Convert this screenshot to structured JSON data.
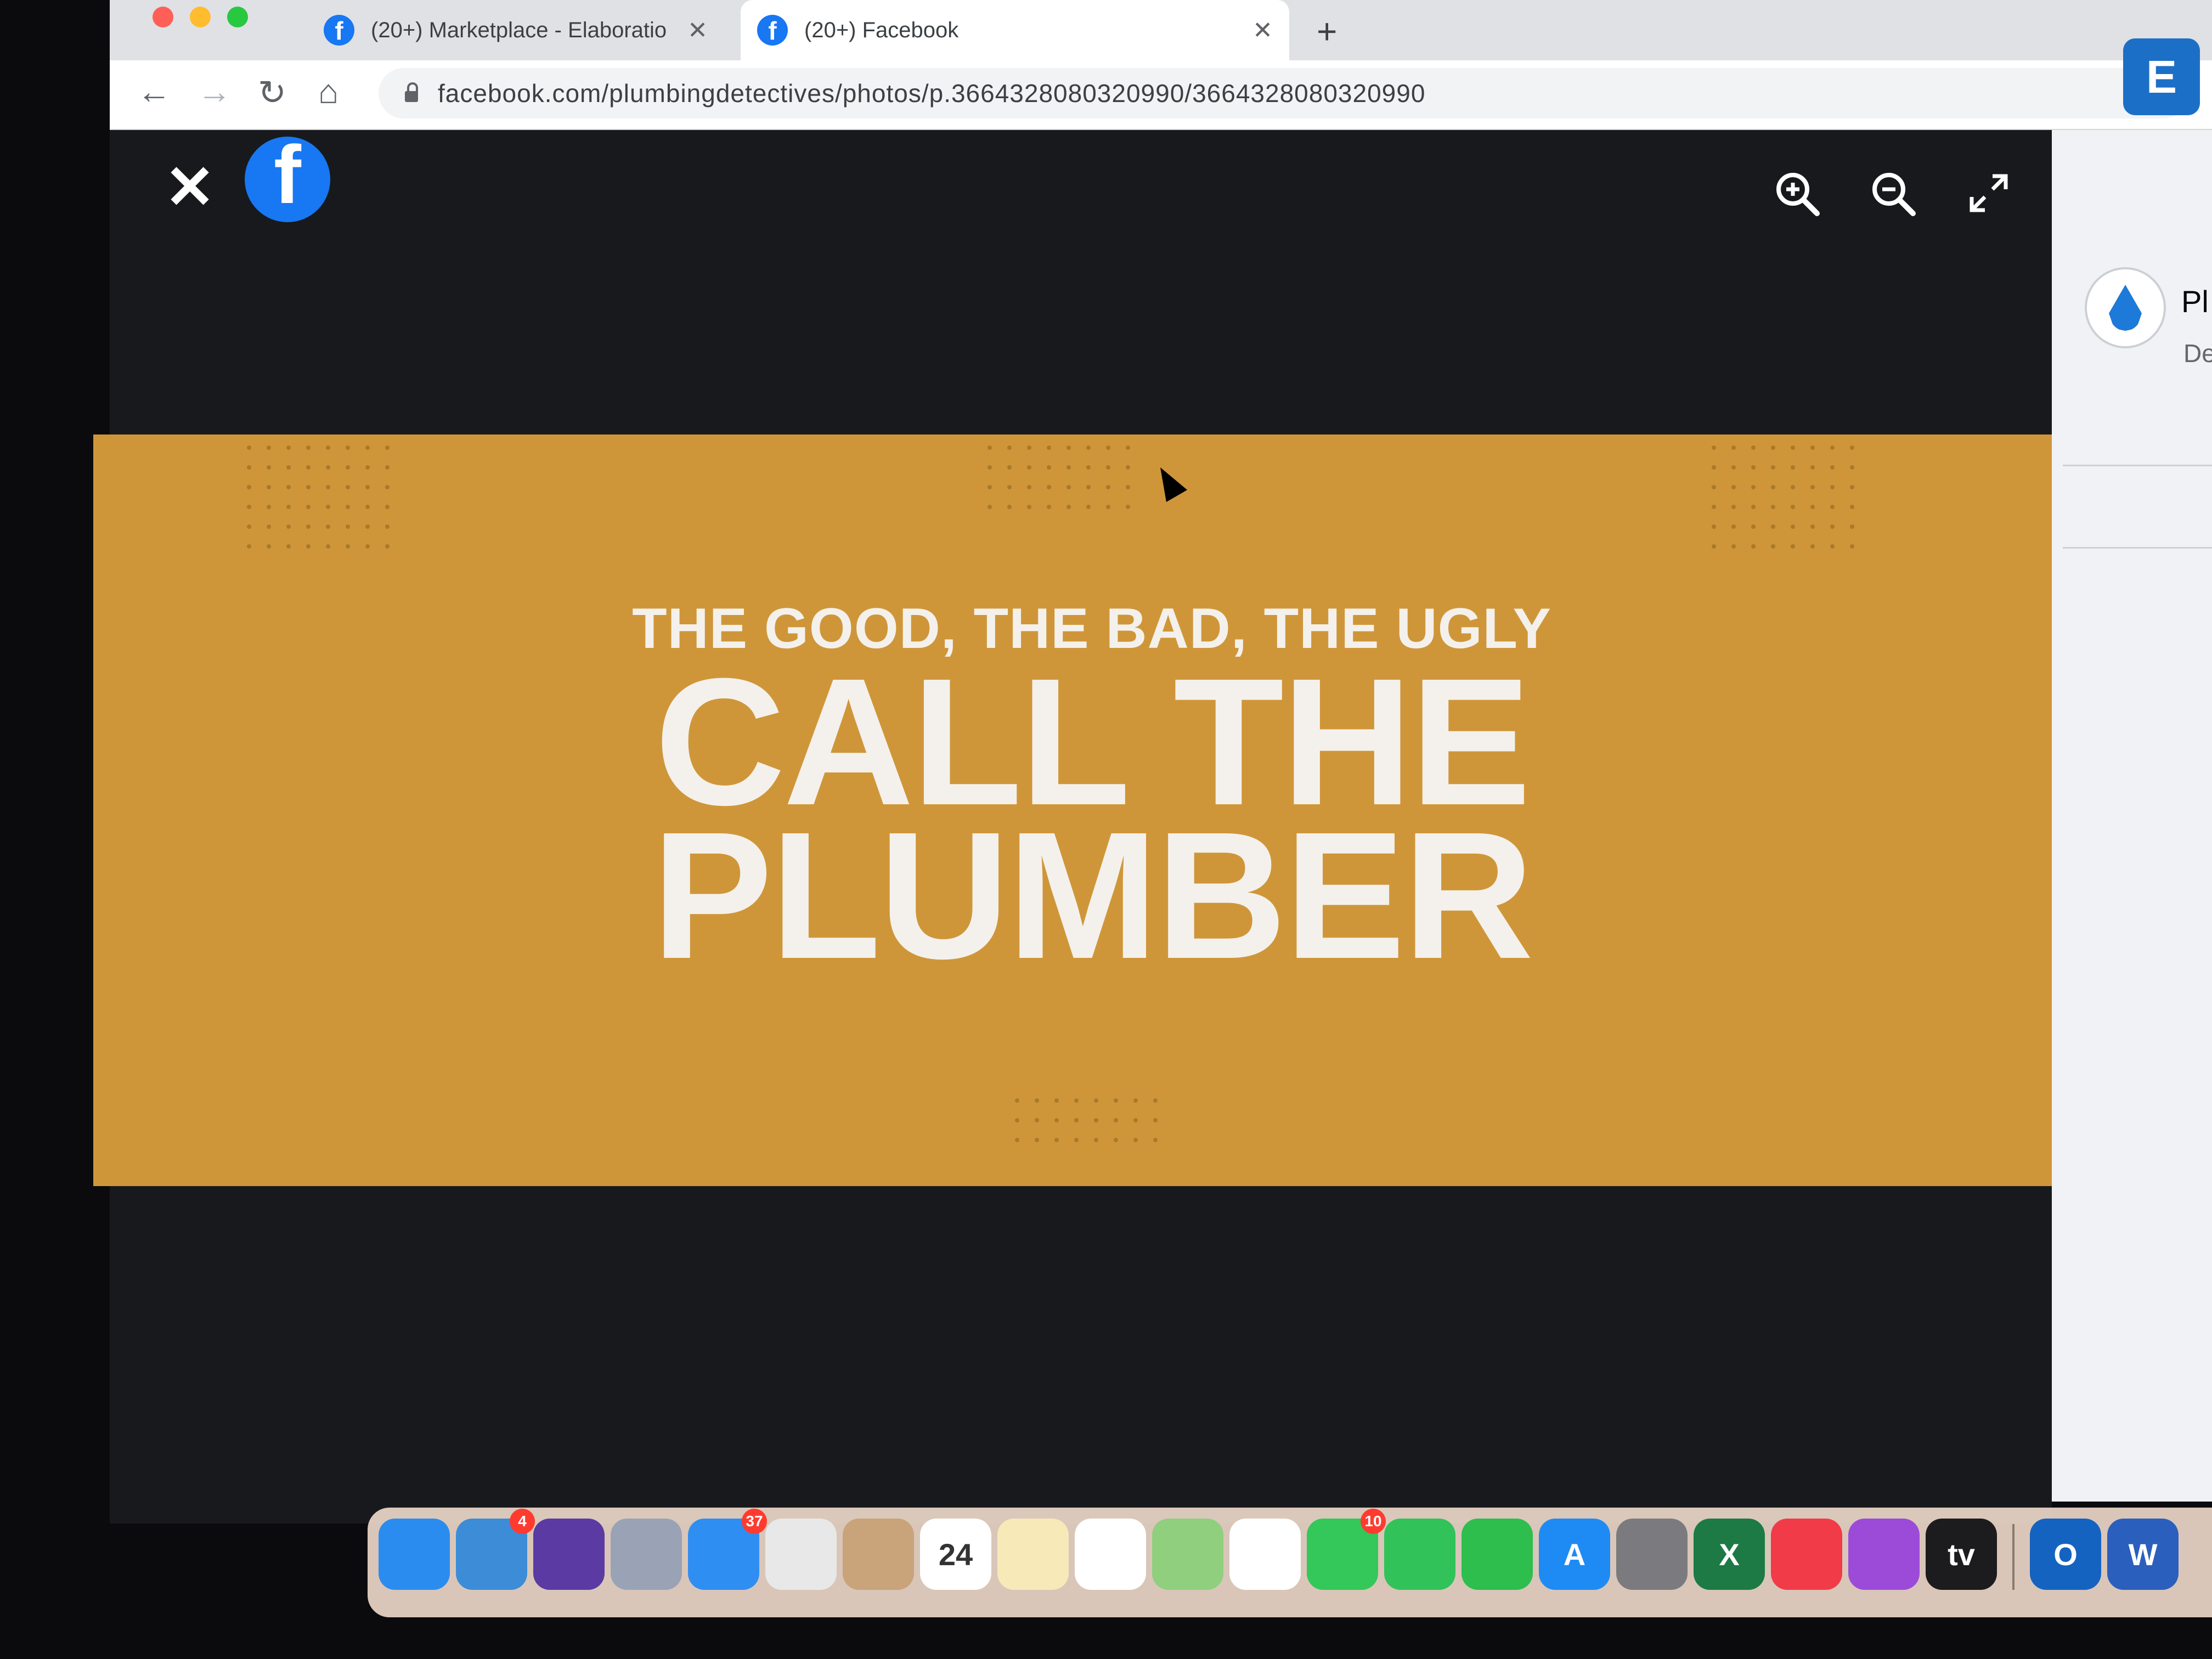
{
  "browser": {
    "tabs": [
      {
        "title": "(20+) Marketplace - Elaboratio",
        "active": false
      },
      {
        "title": "(20+) Facebook",
        "active": true
      }
    ],
    "new_tab_label": "+",
    "url": "facebook.com/plumbingdetectives/photos/p.3664328080320990/3664328080320990",
    "extension_label": "E"
  },
  "viewer": {
    "close_label": "✕",
    "logo_letter": "f"
  },
  "photo": {
    "subtitle": "THE GOOD, THE BAD, THE UGLY",
    "title_line1": "CALL THE",
    "title_line2": "PLUMBER",
    "background_color": "#cf9639"
  },
  "side_panel": {
    "page_name": "Pl",
    "page_sub": "De"
  },
  "dock": {
    "items": [
      {
        "name": "Finder",
        "label": "",
        "color": "#2b8cf0"
      },
      {
        "name": "Safari",
        "label": "",
        "color": "#3d8cd8",
        "badge": "4"
      },
      {
        "name": "Siri",
        "label": "",
        "color": "#5b3aa3"
      },
      {
        "name": "Launchpad",
        "label": "",
        "color": "#9aa3b5"
      },
      {
        "name": "Mail",
        "label": "",
        "color": "#2f8ef2",
        "badge": "37"
      },
      {
        "name": "Chrome",
        "label": "",
        "color": "#e8e8e8"
      },
      {
        "name": "Contacts",
        "label": "",
        "color": "#c9a37a"
      },
      {
        "name": "Calendar",
        "label": "24",
        "color": "#ffffff"
      },
      {
        "name": "Notes",
        "label": "",
        "color": "#f7e9b8"
      },
      {
        "name": "Reminders",
        "label": "",
        "color": "#ffffff"
      },
      {
        "name": "Maps",
        "label": "",
        "color": "#8fcf7e"
      },
      {
        "name": "Photos",
        "label": "",
        "color": "#ffffff"
      },
      {
        "name": "Messages",
        "label": "",
        "color": "#34c759",
        "badge": "10"
      },
      {
        "name": "FaceTime",
        "label": "",
        "color": "#32c25a"
      },
      {
        "name": "Numbers",
        "label": "",
        "color": "#2dbe4e"
      },
      {
        "name": "App Store",
        "label": "A",
        "color": "#1e8bf5"
      },
      {
        "name": "System Preferences",
        "label": "",
        "color": "#7b7b7f"
      },
      {
        "name": "Excel",
        "label": "X",
        "color": "#1d7a45"
      },
      {
        "name": "News",
        "label": "",
        "color": "#f23b48"
      },
      {
        "name": "Podcasts",
        "label": "",
        "color": "#9b4bd8"
      },
      {
        "name": "Apple TV",
        "label": "tv",
        "color": "#1c1c1e"
      }
    ],
    "right_items": [
      {
        "name": "Outlook",
        "label": "O",
        "color": "#1463c0"
      },
      {
        "name": "Word",
        "label": "W",
        "color": "#2a5fbd"
      }
    ]
  }
}
